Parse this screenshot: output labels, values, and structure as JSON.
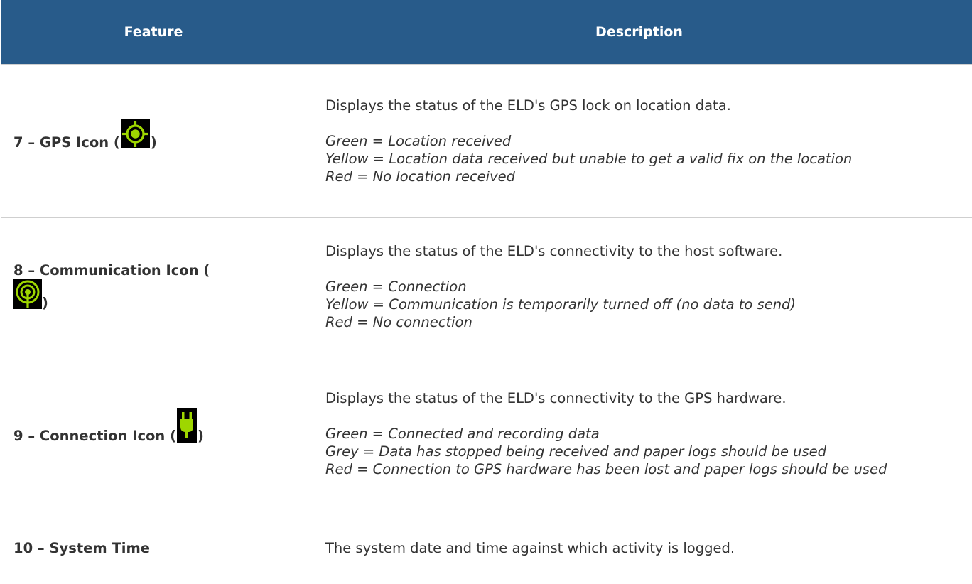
{
  "table": {
    "headers": {
      "feature": "Feature",
      "description": "Description"
    },
    "rows": [
      {
        "feature_prefix": "7 – GPS Icon (",
        "feature_suffix": ")",
        "icon": "gps-target-icon",
        "description": "Displays the status of the ELD's GPS lock on location data.",
        "legend": [
          "Green = Location received",
          "Yellow = Location data received but unable to get a valid fix on the location",
          "Red = No location received"
        ]
      },
      {
        "feature_prefix": "8 – Communication Icon (",
        "feature_suffix": ")",
        "icon": "antenna-signal-icon",
        "description": "Displays the status of the ELD's connectivity to the host software.",
        "legend": [
          "Green = Connection",
          "Yellow = Communication is temporarily turned off (no data to send)",
          "Red = No connection"
        ]
      },
      {
        "feature_prefix": "9 – Connection Icon (",
        "feature_suffix": ")",
        "icon": "power-plug-icon",
        "description": "Displays the status of the ELD's connectivity to the GPS hardware.",
        "legend": [
          "Green = Connected and recording data",
          "Grey = Data has stopped being received and paper logs should be used",
          "Red = Connection to GPS hardware has been lost and paper logs should be used"
        ]
      },
      {
        "feature": "10 – System Time",
        "description": "The system date and time against which activity is logged."
      }
    ]
  },
  "colors": {
    "header_bg": "#285b8a",
    "header_text": "#ffffff",
    "body_text": "#333333",
    "border": "#cfcfcf",
    "icon_bg": "#000000",
    "icon_green": "#9ed600"
  }
}
